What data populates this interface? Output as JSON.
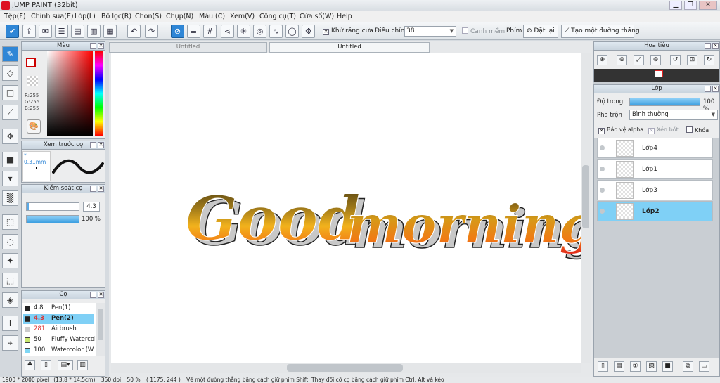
{
  "window": {
    "title": "JUMP PAINT (32bit)",
    "minimize": "▁",
    "restore": "❐",
    "close": "✕"
  },
  "menu": [
    "Tệp(F)",
    "Chỉnh sửa(E)",
    "Lớp(L)",
    "Bộ lọc(R)",
    "Chọn(S)",
    "Chụp(N)",
    "Màu (C)",
    "Xem(V)",
    "Công cụ(T)",
    "Cửa sổ(W)",
    "Help"
  ],
  "toolbar": {
    "antialias_label": "Khử răng cưa",
    "adjust_label": "Điều chỉnh",
    "adjust_value": "38",
    "align_label": "Canh mềm",
    "key_label": "Phím",
    "reset_label": "Đặt lại",
    "create_line_label": "Tạo một đường thẳng"
  },
  "color_panel": {
    "title": "Màu",
    "r": "R:255",
    "g": "G:255",
    "b": "B:255"
  },
  "brush_preview": {
    "title": "Xem trước cọ",
    "size": "* 0.31mm"
  },
  "brush_control": {
    "title": "Kiểm soát cọ",
    "size_value": "4.3",
    "opacity_value": "100 %"
  },
  "brushes": {
    "title": "Cọ",
    "items": [
      {
        "size": "4.8",
        "name": "Pen(1)",
        "color": "#222222"
      },
      {
        "size": "4.3",
        "name": "Pen(2)",
        "color": "#222222",
        "selected": true
      },
      {
        "size": "281",
        "name": "Airbrush",
        "color": "#cccccc"
      },
      {
        "size": "50",
        "name": "Fluffy Watercolor",
        "color": "#c8e870"
      },
      {
        "size": "100",
        "name": "Watercolor (W",
        "color": "#7fd7f5"
      }
    ]
  },
  "tabs": [
    "Untitled",
    "Untitled"
  ],
  "canvas": {
    "word1": "Good",
    "word2": "morning"
  },
  "navigator": {
    "title": "Hoa tiêu"
  },
  "layers_panel": {
    "title": "Lớp",
    "opacity_label": "Độ trong",
    "opacity_value": "100 %",
    "blend_label": "Pha trộn",
    "blend_value": "Bình thường",
    "protect_alpha": "Bảo vệ alpha",
    "clip": "Xén bớt",
    "lock": "Khóa",
    "layers": [
      {
        "name": "Lớp4",
        "selected": false
      },
      {
        "name": "Lớp1",
        "selected": false
      },
      {
        "name": "Lớp3",
        "selected": false
      },
      {
        "name": "Lớp2",
        "selected": true
      }
    ]
  },
  "status": {
    "dims": "1900 * 2000 pixel",
    "cm": "(13.8 * 14.5cm)",
    "dpi": "350 dpi",
    "zoom": "50 %",
    "coords": "( 1175, 244 )",
    "hint": "Vẽ một đường thẳng bằng cách giữ phím Shift, Thay đổi cỡ cọ bằng cách giữ phím Ctrl, Alt và kéo"
  },
  "colors": {
    "accent": "#2f86d6",
    "selected_layer": "#7fd0f6"
  }
}
